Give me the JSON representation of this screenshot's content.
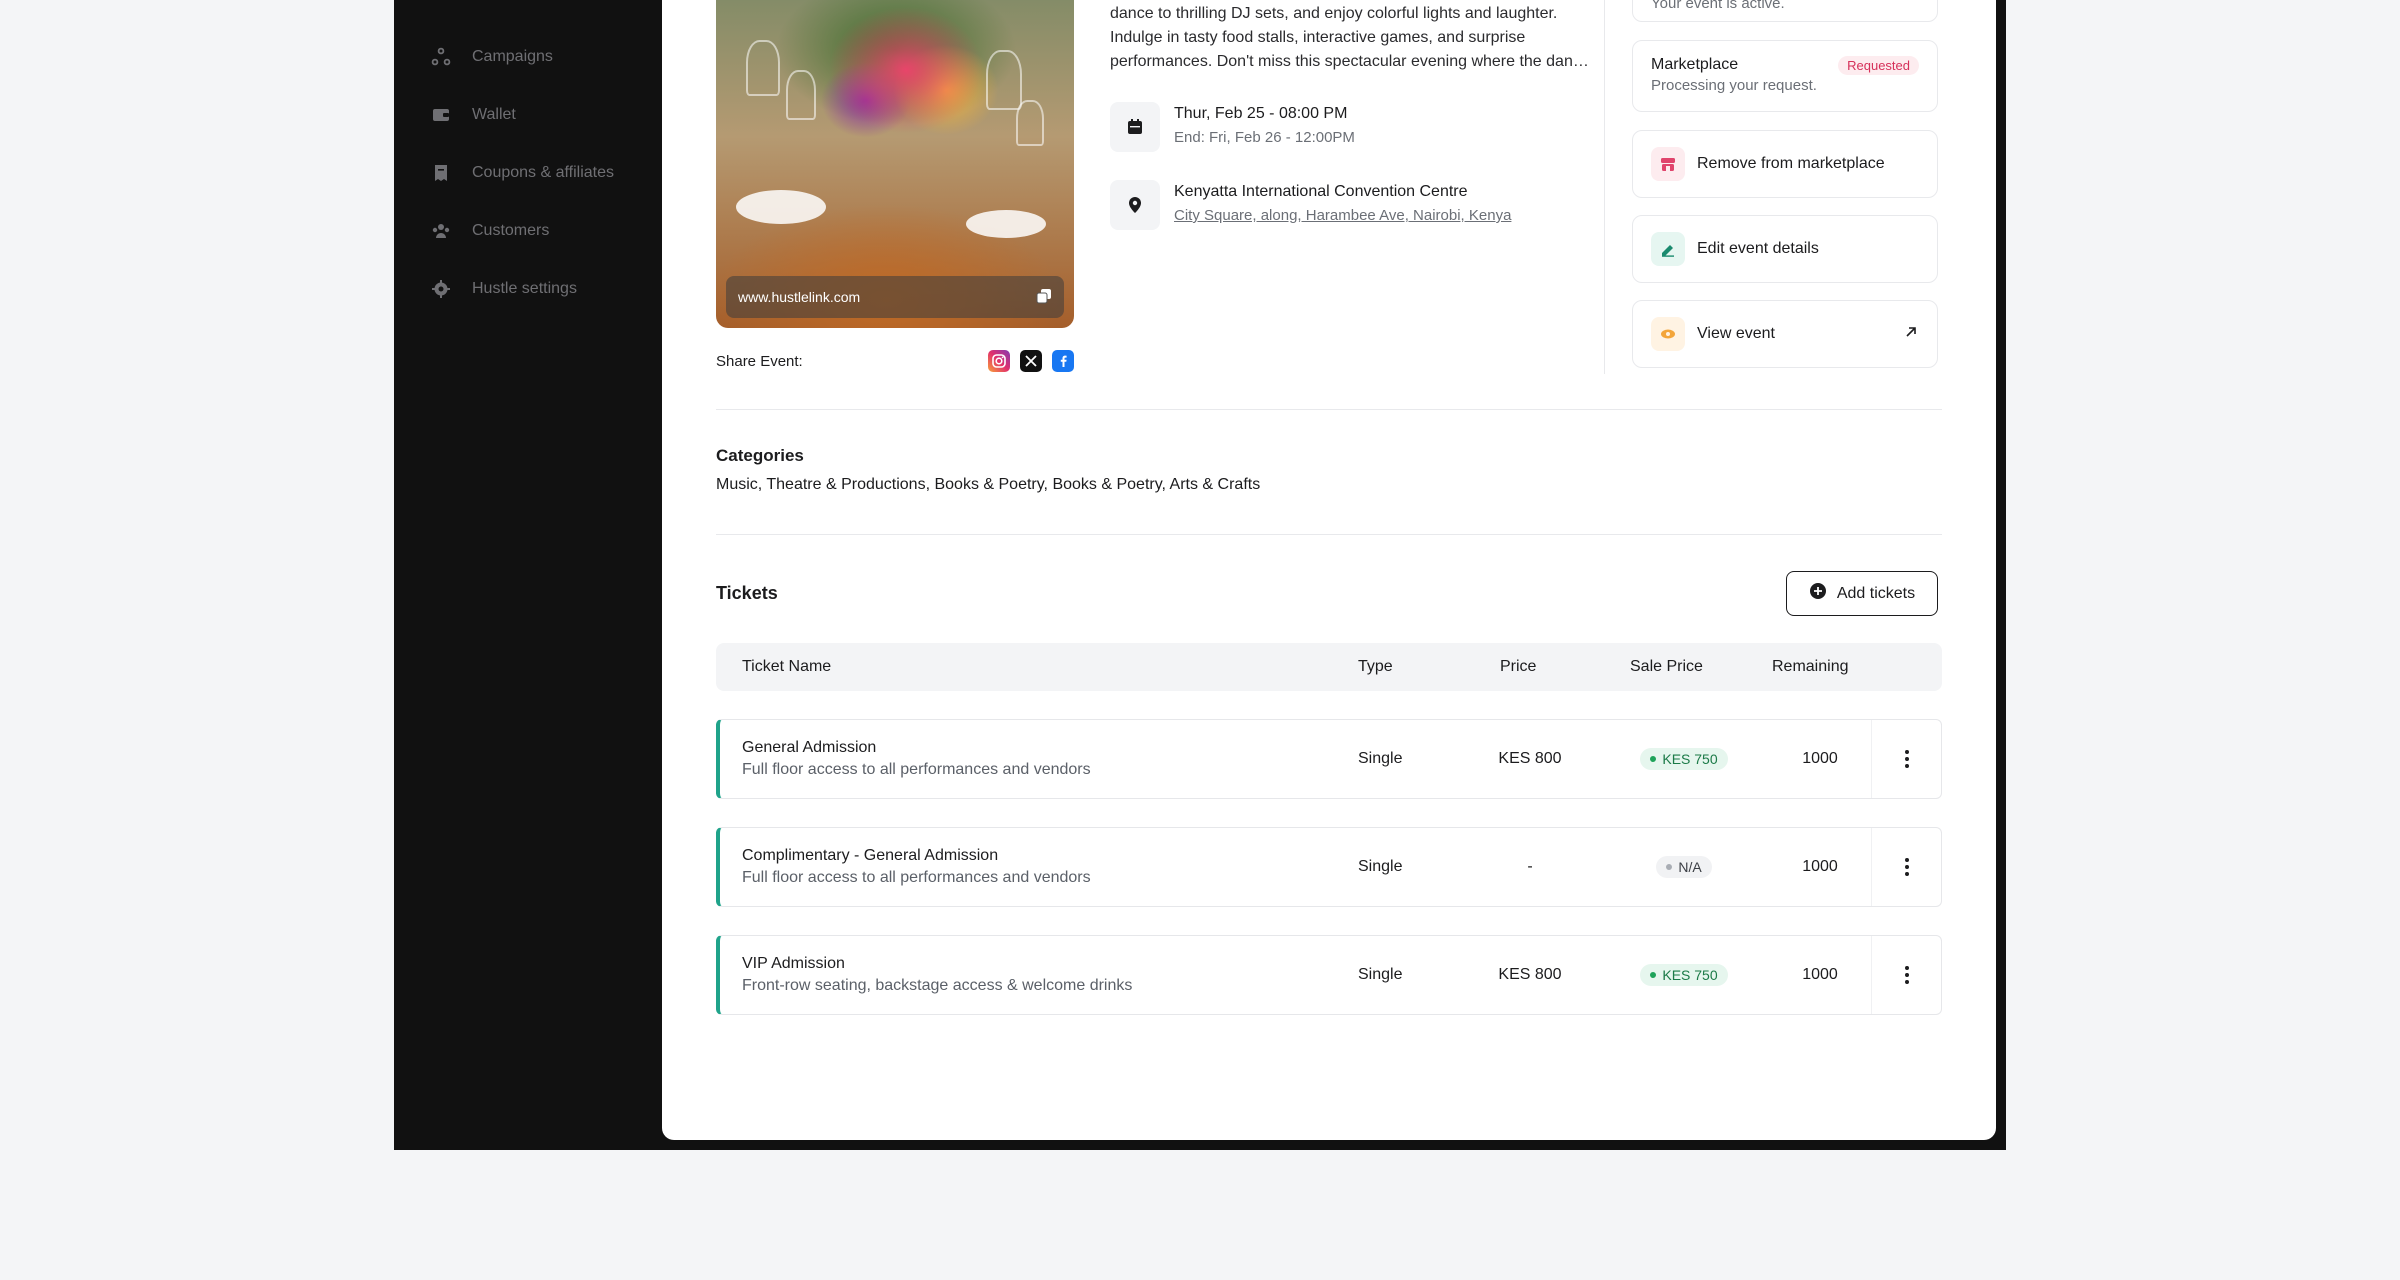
{
  "sidebar": {
    "items": [
      {
        "label": "Campaigns",
        "icon": "campaigns-icon"
      },
      {
        "label": "Wallet",
        "icon": "wallet-icon"
      },
      {
        "label": "Coupons & affiliates",
        "icon": "coupon-icon"
      },
      {
        "label": "Customers",
        "icon": "customers-icon"
      },
      {
        "label": "Hustle settings",
        "icon": "settings-icon"
      }
    ]
  },
  "event": {
    "url": "www.hustlelink.com",
    "share_label": "Share Event:",
    "description_lines": [
      "dance to thrilling DJ sets, and enjoy colorful lights and laughter.",
      "Indulge in tasty food stalls, interactive games, and surprise",
      "performances. Don't miss this spectacular evening where the danc..."
    ],
    "start": "Thur, Feb 25 - 08:00 PM",
    "end": "End: Fri, Feb 26 - 12:00PM",
    "venue": "Kenyatta International Convention Centre",
    "address": "City Square, along, Harambee Ave, Nairobi, Kenya"
  },
  "actions": {
    "active_text": "Your event is active.",
    "marketplace_title": "Marketplace",
    "marketplace_status": "Requested",
    "marketplace_sub": "Processing your request.",
    "remove_label": "Remove from marketplace",
    "edit_label": "Edit event details",
    "view_label": "View event"
  },
  "categories": {
    "title": "Categories",
    "text": "Music, Theatre & Productions, Books & Poetry, Books & Poetry, Arts & Crafts"
  },
  "tickets": {
    "title": "Tickets",
    "add_label": "Add tickets",
    "headers": {
      "name": "Ticket Name",
      "type": "Type",
      "price": "Price",
      "sale": "Sale Price",
      "remaining": "Remaining"
    },
    "rows": [
      {
        "name": "General Admission",
        "desc": "Full floor access to all performances and vendors",
        "type": "Single",
        "price": "KES 800",
        "sale": "KES 750",
        "sale_status": "green",
        "remaining": "1000"
      },
      {
        "name": "Complimentary - General Admission",
        "desc": "Full floor access to all performances and vendors",
        "type": "Single",
        "price": "-",
        "sale": "N/A",
        "sale_status": "grey",
        "remaining": "1000"
      },
      {
        "name": "VIP Admission",
        "desc": "Front-row seating, backstage access & welcome drinks",
        "type": "Single",
        "price": "KES 800",
        "sale": "KES 750",
        "sale_status": "green",
        "remaining": "1000"
      }
    ]
  },
  "colors": {
    "accent_teal": "#1fa38a",
    "badge_red": "#d6305a",
    "sale_green": "#1b7a47"
  }
}
